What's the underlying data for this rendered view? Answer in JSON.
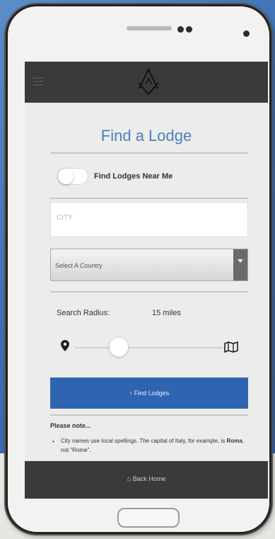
{
  "header": {
    "menu_icon": "hamburger-icon",
    "logo_icon": "square-and-compasses-icon"
  },
  "page": {
    "title": "Find a Lodge"
  },
  "near_me": {
    "label": "Find Lodges Near Me",
    "enabled": false
  },
  "city": {
    "placeholder": "CITY",
    "value": ""
  },
  "country": {
    "selected": "Select A Country"
  },
  "radius": {
    "label": "Search Radius:",
    "value_text": "15 miles",
    "fraction": 0.3,
    "min_icon": "map-pin-icon",
    "max_icon": "map-icon"
  },
  "find_button": {
    "label": "↑ Find Lodges"
  },
  "notes": {
    "title": "Please note...",
    "items": [
      {
        "text_a": "City names use local spellings. The capital of Italy, for example, is ",
        "text_bold": "Roma",
        "text_b": ", not \"Rome\"."
      }
    ]
  },
  "footer": {
    "back_home_label": "⌂ Back Home"
  },
  "colors": {
    "accent_blue": "#2f64b1",
    "title_blue": "#4c7fbf",
    "bar_dark": "#3a3a38"
  }
}
